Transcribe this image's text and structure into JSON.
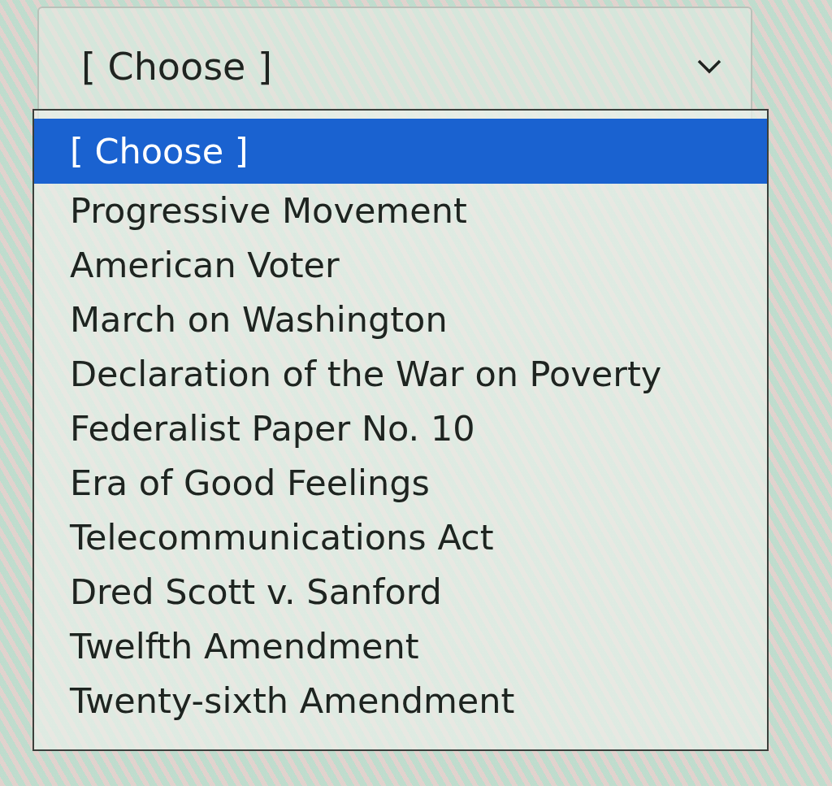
{
  "select": {
    "value": "[ Choose ]",
    "expanded": true
  },
  "options": [
    {
      "label": "[ Choose ]",
      "selected": true
    },
    {
      "label": "Progressive Movement",
      "selected": false
    },
    {
      "label": "American Voter",
      "selected": false
    },
    {
      "label": "March on Washington",
      "selected": false
    },
    {
      "label": "Declaration of the War on Poverty",
      "selected": false
    },
    {
      "label": "Federalist Paper No. 10",
      "selected": false
    },
    {
      "label": "Era of Good Feelings",
      "selected": false
    },
    {
      "label": "Telecommunications Act",
      "selected": false
    },
    {
      "label": "Dred Scott v. Sanford",
      "selected": false
    },
    {
      "label": "Twelfth Amendment",
      "selected": false
    },
    {
      "label": "Twenty-sixth Amendment",
      "selected": false
    }
  ]
}
